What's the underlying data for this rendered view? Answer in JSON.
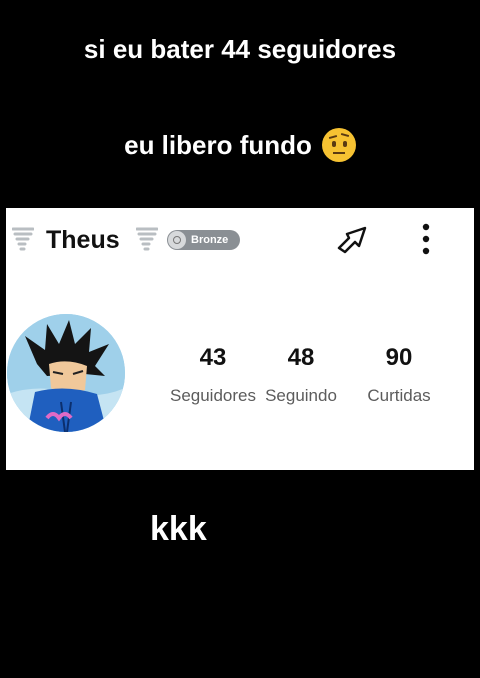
{
  "captions": {
    "top_line_1": "si eu bater 44 seguidores",
    "top_line_2": "eu libero fundo",
    "bottom": "kkk"
  },
  "profile": {
    "username": "Theus",
    "badge": "Bronze",
    "stats": [
      {
        "value": "43",
        "label": "Seguidores"
      },
      {
        "value": "48",
        "label": "Seguindo"
      },
      {
        "value": "90",
        "label": "Curtidas"
      }
    ]
  },
  "icons": {
    "caption_emoji": "face-with-raised-eyebrow-icon",
    "name_decoration": "tornado-icon",
    "badge_icon": "badge-icon",
    "share": "share-icon",
    "more": "more-vertical-icon"
  },
  "colors": {
    "background": "#000000",
    "card": "#ffffff",
    "badge": "#8a8f94"
  }
}
